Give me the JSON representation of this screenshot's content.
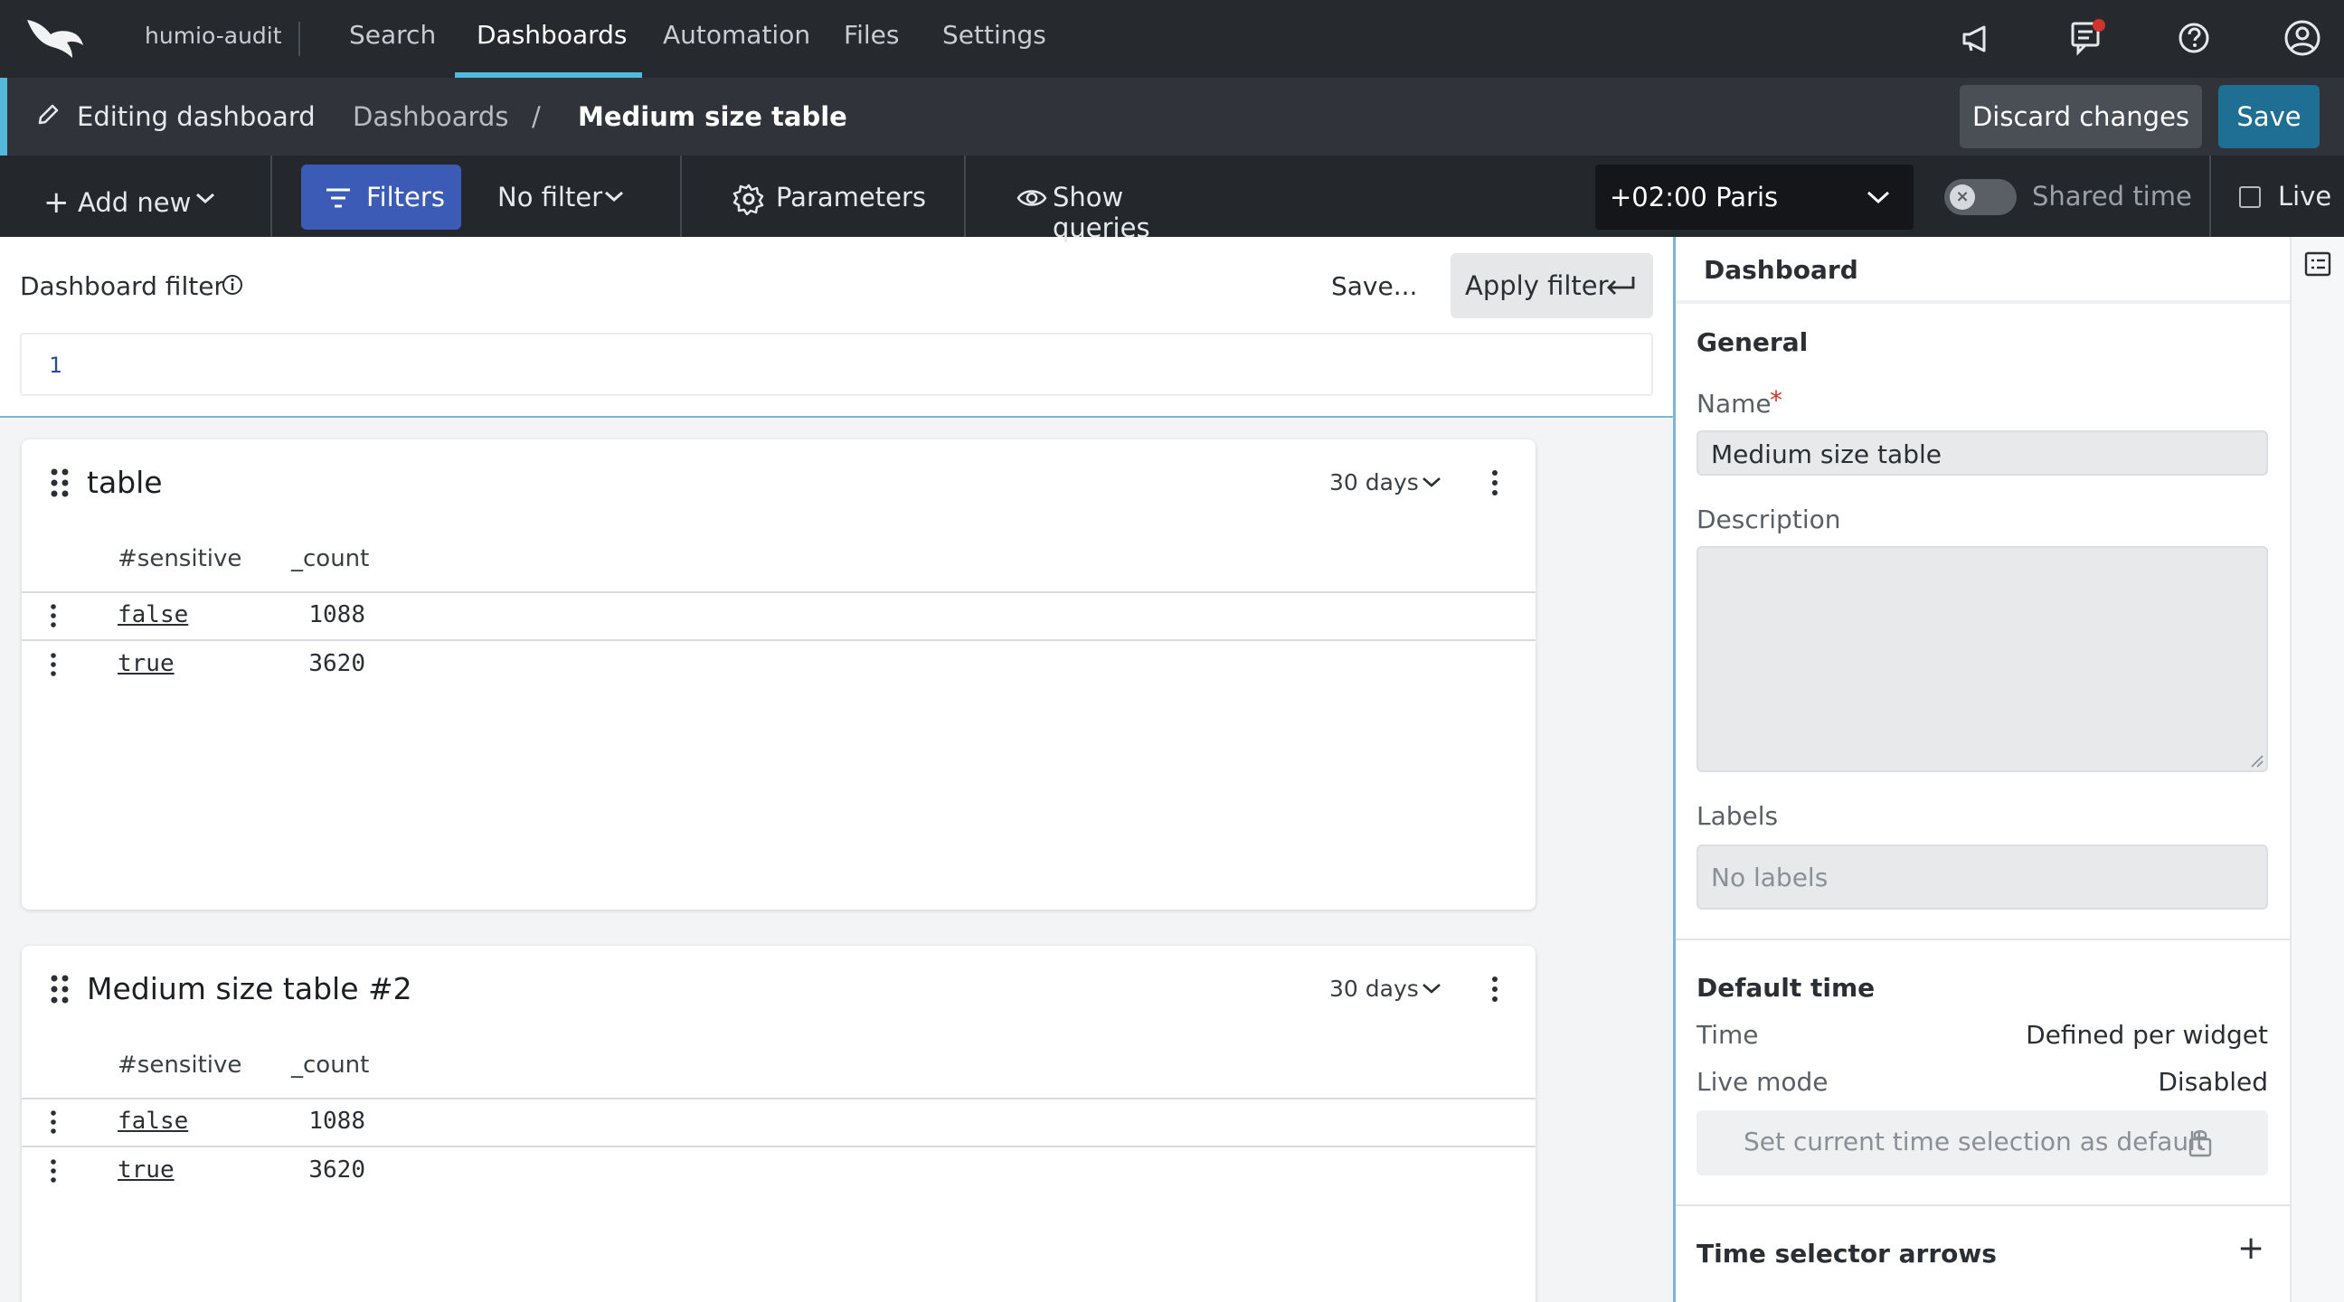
{
  "nav": {
    "org": "humio-audit",
    "items": [
      {
        "label": "Search"
      },
      {
        "label": "Dashboards"
      },
      {
        "label": "Automation"
      },
      {
        "label": "Files"
      },
      {
        "label": "Settings"
      }
    ],
    "active_item": "Dashboards",
    "icons": [
      "logo-falcon-icon",
      "megaphone-icon",
      "notifications-icon",
      "help-icon",
      "user-icon"
    ]
  },
  "editbar": {
    "mode_label": "Editing dashboard",
    "breadcrumb_root": "Dashboards",
    "separator": "/",
    "current": "Medium size table",
    "discard_label": "Discard changes",
    "save_label": "Save"
  },
  "toolbar": {
    "add_new": "Add new",
    "filters": "Filters",
    "no_filter": "No filter",
    "parameters": "Parameters",
    "show_queries": "Show queries",
    "timezone": "+02:00 Paris",
    "shared_time": "Shared time",
    "live": "Live"
  },
  "filter": {
    "label": "Dashboard filter",
    "save": "Save...",
    "apply": "Apply filter",
    "apply_icon": "↵",
    "line_number": "1"
  },
  "widgets": [
    {
      "title": "table",
      "time": "30 days",
      "columns": [
        "#sensitive",
        "_count"
      ],
      "rows": [
        {
          "sensitive": "false",
          "count": "1088"
        },
        {
          "sensitive": "true",
          "count": "3620"
        }
      ]
    },
    {
      "title": "Medium size table #2",
      "time": "30 days",
      "columns": [
        "#sensitive",
        "_count"
      ],
      "rows": [
        {
          "sensitive": "false",
          "count": "1088"
        },
        {
          "sensitive": "true",
          "count": "3620"
        }
      ]
    }
  ],
  "panel": {
    "title": "Dashboard",
    "general": "General",
    "name_label": "Name",
    "required_mark": "*",
    "name_value": "Medium size table",
    "description_label": "Description",
    "labels_label": "Labels",
    "labels_placeholder": "No labels",
    "default_time": "Default time",
    "time_label": "Time",
    "time_value": "Defined per widget",
    "live_mode_label": "Live mode",
    "live_mode_value": "Disabled",
    "set_default": "Set current time selection as default",
    "time_selector_arrows": "Time selector arrows",
    "add_icon": "+"
  },
  "colors": {
    "accent": "#53b8d9",
    "primary_button": "#1e6f93",
    "filters_button": "#3b5bb6",
    "required": "#d0342c"
  }
}
